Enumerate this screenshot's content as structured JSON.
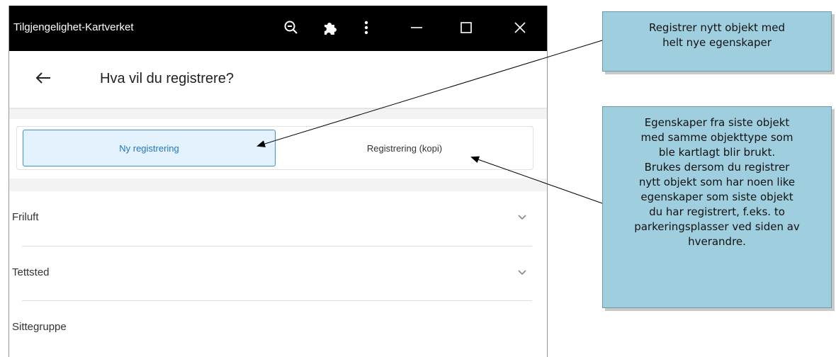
{
  "window": {
    "title": "Tilgjengelighet-Kartverket",
    "controls": [
      "zoom-out-icon",
      "extension-icon",
      "more-vert-icon",
      "minimize-icon",
      "maximize-icon",
      "close-icon"
    ]
  },
  "header": {
    "back_icon": "arrow-left-icon",
    "title": "Hva vil du registrere?"
  },
  "tabs": [
    {
      "label": "Ny registrering",
      "selected": true
    },
    {
      "label": "Registrering (kopi)",
      "selected": false
    }
  ],
  "list": [
    {
      "label": "Friluft",
      "chevron": "chevron-down-icon"
    },
    {
      "label": "Tettsted",
      "chevron": "chevron-down-icon"
    },
    {
      "label": "Sittegruppe"
    }
  ],
  "callouts": {
    "new": {
      "lines": [
        "Registrer nytt objekt med",
        "helt nye egenskaper"
      ]
    },
    "copy": {
      "lines": [
        "Egenskaper fra siste objekt",
        "med samme objekttype som",
        "ble kartlagt blir brukt.",
        "Brukes dersom du registrer",
        "nytt objekt som har noen like",
        "egenskaper som siste objekt",
        "du har registrert, f.eks. to",
        "parkeringsplasser ved siden av",
        "hverandre."
      ]
    }
  },
  "colors": {
    "titlebar": "#000000",
    "tab_selected_bg": "#e3f2fd",
    "tab_selected_border": "#3d8fd6",
    "tab_selected_text": "#1e78c8",
    "callout_bg": "#9fcfdf"
  }
}
